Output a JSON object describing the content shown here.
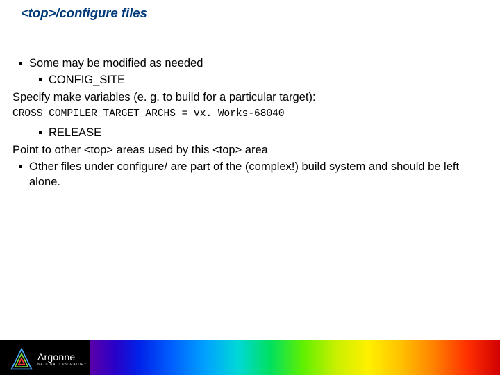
{
  "title": "<top>/configure files",
  "body": {
    "b1": "Some may be modified as needed",
    "b1a": "CONFIG_SITE",
    "b1a_desc": "Specify make variables (e. g. to build for a particular target):",
    "code": "CROSS_COMPILER_TARGET_ARCHS = vx. Works-68040",
    "b1b": "RELEASE",
    "b1b_desc": "Point to other <top> areas used by this <top> area",
    "b2": "Other files under configure/ are part of the (complex!) build system and should be left alone."
  },
  "footer": {
    "logo_name": "Argonne",
    "logo_sub": "NATIONAL LABORATORY"
  }
}
